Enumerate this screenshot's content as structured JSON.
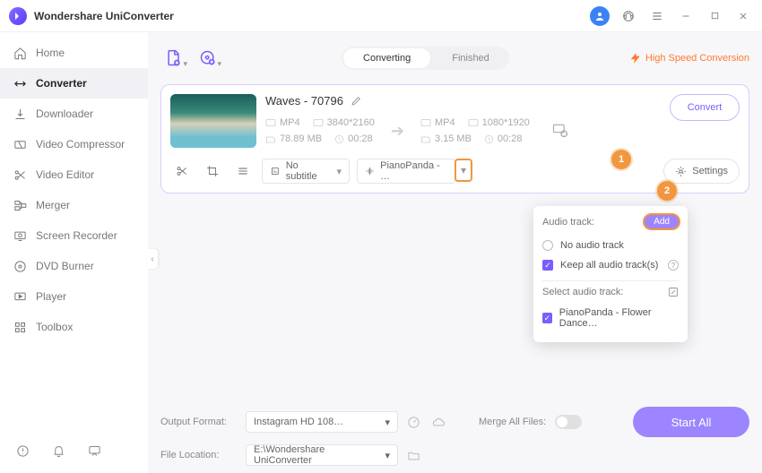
{
  "titlebar": {
    "title": "Wondershare UniConverter"
  },
  "sidebar": {
    "items": [
      {
        "label": "Home"
      },
      {
        "label": "Converter"
      },
      {
        "label": "Downloader"
      },
      {
        "label": "Video Compressor"
      },
      {
        "label": "Video Editor"
      },
      {
        "label": "Merger"
      },
      {
        "label": "Screen Recorder"
      },
      {
        "label": "DVD Burner"
      },
      {
        "label": "Player"
      },
      {
        "label": "Toolbox"
      }
    ]
  },
  "toolbar": {
    "tabs": {
      "converting": "Converting",
      "finished": "Finished"
    },
    "hsc": "High Speed Conversion"
  },
  "card": {
    "filename": "Waves - 70796",
    "src": {
      "format": "MP4",
      "res": "3840*2160",
      "size": "78.89 MB",
      "dur": "00:28"
    },
    "dst": {
      "format": "MP4",
      "res": "1080*1920",
      "size": "3.15 MB",
      "dur": "00:28"
    },
    "convert": "Convert",
    "subtitle_label": "No subtitle",
    "audio_label": "PianoPanda - …",
    "settings": "Settings"
  },
  "popup": {
    "header": "Audio track:",
    "add": "Add",
    "no_audio": "No audio track",
    "keep_all": "Keep all audio track(s)",
    "select_header": "Select audio track:",
    "track1": "PianoPanda - Flower Dance…"
  },
  "callouts": {
    "one": "1",
    "two": "2"
  },
  "footer": {
    "out_label": "Output Format:",
    "out_value": "Instagram HD 108…",
    "loc_label": "File Location:",
    "loc_value": "E:\\Wondershare UniConverter",
    "merge_label": "Merge All Files:",
    "start_all": "Start All"
  }
}
